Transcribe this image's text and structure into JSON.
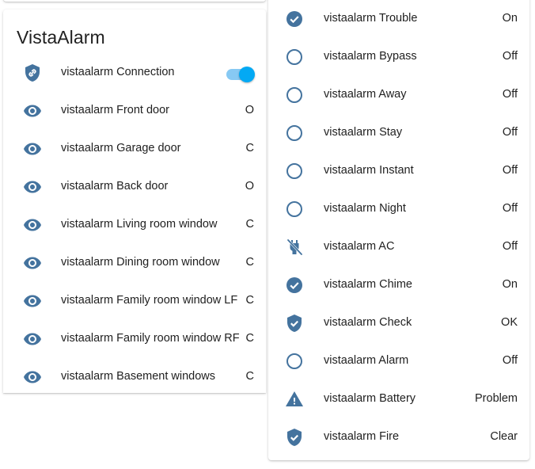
{
  "left_card": {
    "title": "VistaAlarm",
    "rows": [
      {
        "name": "vistaalarm Connection",
        "state": "",
        "icon": "shield-link-icon",
        "toggle_on": true
      },
      {
        "name": "vistaalarm Front door",
        "state": "O",
        "icon": "eye-icon"
      },
      {
        "name": "vistaalarm Garage door",
        "state": "C",
        "icon": "eye-icon"
      },
      {
        "name": "vistaalarm Back door",
        "state": "O",
        "icon": "eye-icon"
      },
      {
        "name": "vistaalarm Living room window",
        "state": "C",
        "icon": "eye-icon"
      },
      {
        "name": "vistaalarm Dining room window",
        "state": "C",
        "icon": "eye-icon"
      },
      {
        "name": "vistaalarm Family room window LF",
        "state": "C",
        "icon": "eye-icon"
      },
      {
        "name": "vistaalarm Family room window RF",
        "state": "C",
        "icon": "eye-icon"
      },
      {
        "name": "vistaalarm Basement windows",
        "state": "C",
        "icon": "eye-icon"
      }
    ]
  },
  "right_card": {
    "rows": [
      {
        "name": "vistaalarm Trouble",
        "state": "On",
        "icon": "check-circle-icon"
      },
      {
        "name": "vistaalarm Bypass",
        "state": "Off",
        "icon": "circle-outline-icon"
      },
      {
        "name": "vistaalarm Away",
        "state": "Off",
        "icon": "circle-outline-icon"
      },
      {
        "name": "vistaalarm Stay",
        "state": "Off",
        "icon": "circle-outline-icon"
      },
      {
        "name": "vistaalarm Instant",
        "state": "Off",
        "icon": "circle-outline-icon"
      },
      {
        "name": "vistaalarm Night",
        "state": "Off",
        "icon": "circle-outline-icon"
      },
      {
        "name": "vistaalarm AC",
        "state": "Off",
        "icon": "power-plug-off-icon"
      },
      {
        "name": "vistaalarm Chime",
        "state": "On",
        "icon": "check-circle-icon"
      },
      {
        "name": "vistaalarm Check",
        "state": "OK",
        "icon": "shield-check-icon"
      },
      {
        "name": "vistaalarm Alarm",
        "state": "Off",
        "icon": "circle-outline-icon"
      },
      {
        "name": "vistaalarm Battery",
        "state": "Problem",
        "icon": "alert-icon"
      },
      {
        "name": "vistaalarm Fire",
        "state": "Clear",
        "icon": "shield-check-icon"
      }
    ]
  },
  "colors": {
    "icon": "#44739e",
    "toggle_thumb": "#03a9f4",
    "toggle_track": "#87c9f3",
    "text": "#212121"
  }
}
